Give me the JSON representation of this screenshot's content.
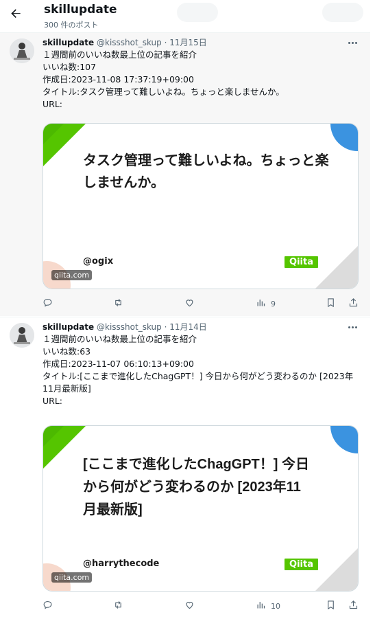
{
  "header": {
    "title": "skillupdate",
    "post_count": "300 件のポスト"
  },
  "tweets": [
    {
      "name": "skillupdate",
      "handle": "@kissshot_skup",
      "dot": "·",
      "date": "11月15日",
      "lines": [
        "１週間前のいいね数最上位の記事を紹介",
        "いいね数:107",
        "作成日:2023-11-08 17:37:19+09:00",
        "タイトル:タスク管理って難しいよね。ちょっと楽しませんか。",
        "URL:"
      ],
      "card": {
        "title": "タスク管理って難しいよね。ちょっと楽しませんか。",
        "author": "@ogix",
        "logo": "Qiita",
        "domain": "qiita.com"
      },
      "views": "9"
    },
    {
      "name": "skillupdate",
      "handle": "@kissshot_skup",
      "dot": "·",
      "date": "11月14日",
      "lines": [
        "１週間前のいいね数最上位の記事を紹介",
        "いいね数:63",
        "作成日:2023-11-07 06:10:13+09:00",
        "タイトル:[ここまで進化したChagGPT！] 今日から何がどう変わるのか [2023年11月最新版]",
        "URL:"
      ],
      "card": {
        "title": "[ここまで進化したChagGPT！] 今日から何がどう変わるのか [2023年11月最新版]",
        "author": "@harrythecode",
        "logo": "Qiita",
        "domain": "qiita.com"
      },
      "views": "10"
    }
  ],
  "colors": {
    "qiita_green": "#55c500",
    "accent_blue": "#3b93e0",
    "muted_text": "#536471"
  },
  "icons": [
    "back-arrow-icon",
    "more-icon",
    "reply-icon",
    "retweet-icon",
    "like-icon",
    "views-icon",
    "bookmark-icon",
    "share-icon"
  ]
}
